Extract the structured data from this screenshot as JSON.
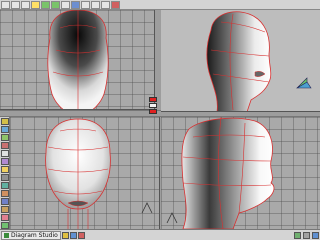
{
  "toolbar": {
    "buttons": [
      {
        "icon": "new-file-icon"
      },
      {
        "icon": "open-icon"
      },
      {
        "icon": "save-icon"
      },
      {
        "icon": "select-icon"
      },
      {
        "icon": "move-icon"
      },
      {
        "icon": "rotate-icon"
      },
      {
        "icon": "scale-icon"
      },
      {
        "icon": "edit-mesh-icon"
      },
      {
        "icon": "point-icon"
      },
      {
        "icon": "edge-icon"
      },
      {
        "icon": "face-icon"
      },
      {
        "icon": "render-icon"
      }
    ]
  },
  "viewports": {
    "front": {
      "name": "front-view"
    },
    "perspective": {
      "name": "perspective-view"
    },
    "top": {
      "name": "top-view"
    },
    "side": {
      "name": "side-view"
    }
  },
  "palette": {
    "icons": [
      "sphere-icon",
      "cube-icon",
      "cylinder-icon",
      "cone-icon",
      "plane-icon",
      "torus-icon",
      "light-icon",
      "camera-icon",
      "spline-icon",
      "bone-icon",
      "material-icon",
      "texture-icon",
      "paint-icon",
      "deform-icon"
    ]
  },
  "status": {
    "start_label": "Diagram Studio"
  },
  "colors": {
    "accent": "#e02020",
    "wire": "#d83030",
    "viewport_bg": "#a9a9a9"
  }
}
